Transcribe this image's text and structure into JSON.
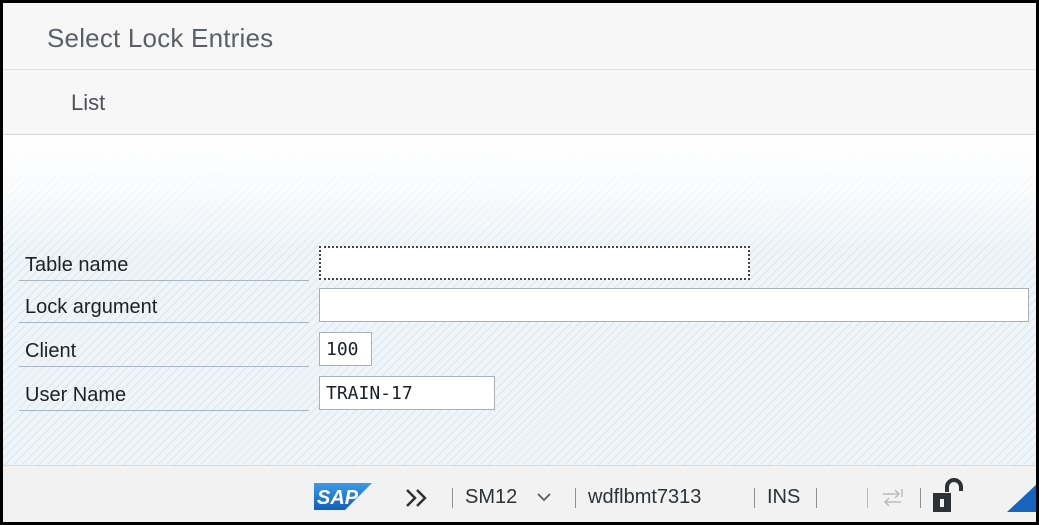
{
  "window": {
    "title": "Select Lock Entries"
  },
  "menu": {
    "list_label": "List"
  },
  "form": {
    "table_name": {
      "label": "Table name",
      "value": ""
    },
    "lock_argument": {
      "label": "Lock argument",
      "value": ""
    },
    "client": {
      "label": "Client",
      "value": "100"
    },
    "user_name": {
      "label": "User Name",
      "value": "TRAIN-17"
    }
  },
  "status_bar": {
    "logo_text": "SAP",
    "more_icon": "double-chevron-right-icon",
    "transaction": "SM12",
    "dropdown_icon": "chevron-down-icon",
    "server": "wdflbmt7313",
    "input_mode": "INS",
    "transfer_icon": "transfer-arrows-icon",
    "lock_icon": "unlock-icon",
    "accent_color": "#1565c0",
    "logo_color": "#1a6fc9"
  }
}
